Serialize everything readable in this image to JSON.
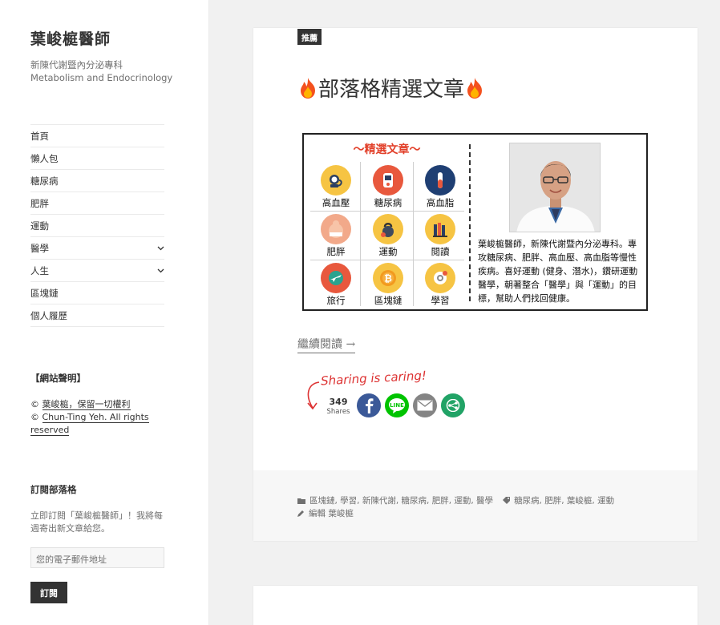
{
  "site": {
    "title": "葉峻榳醫師",
    "tagline_1": "新陳代謝暨內分泌專科",
    "tagline_2": "Metabolism and Endocrinology"
  },
  "nav": [
    {
      "label": "首頁",
      "has_submenu": false
    },
    {
      "label": "懶人包",
      "has_submenu": false
    },
    {
      "label": "糖尿病",
      "has_submenu": false
    },
    {
      "label": "肥胖",
      "has_submenu": false
    },
    {
      "label": "運動",
      "has_submenu": false
    },
    {
      "label": "醫學",
      "has_submenu": true
    },
    {
      "label": "人生",
      "has_submenu": true
    },
    {
      "label": "區塊鏈",
      "has_submenu": false
    },
    {
      "label": "個人履歷",
      "has_submenu": false
    }
  ],
  "notice_widget": {
    "title": "【網站聲明】",
    "line1_prefix": "© ",
    "line1_link": "葉峻榳，保留一切權利",
    "line2_prefix": "© ",
    "line2_link": "Chun-Ting Yeh. All rights reserved"
  },
  "subscribe_widget": {
    "title": "訂閱部落格",
    "text": "立即訂閱「葉峻榳醫師」！我將每週寄出新文章給您。",
    "email_placeholder": "您的電子郵件地址",
    "button_label": "訂閱"
  },
  "post": {
    "badge": "推薦",
    "title": "部落格精選文章",
    "featured_heading": "～精選文章～",
    "categories_grid": [
      {
        "label": "高血壓",
        "icon": "blood-pressure-icon",
        "color": "#f6c443"
      },
      {
        "label": "糖尿病",
        "icon": "glucose-meter-icon",
        "color": "#e8583d"
      },
      {
        "label": "高血脂",
        "icon": "test-tube-icon",
        "color": "#1f3f73"
      },
      {
        "label": "肥胖",
        "icon": "obesity-icon",
        "color": "#f2a98a"
      },
      {
        "label": "運動",
        "icon": "kettlebell-icon",
        "color": "#f6c443"
      },
      {
        "label": "閱讀",
        "icon": "books-icon",
        "color": "#f6c443"
      },
      {
        "label": "旅行",
        "icon": "airplane-icon",
        "color": "#e8583d"
      },
      {
        "label": "區塊鏈",
        "icon": "bitcoin-icon",
        "color": "#f6c443"
      },
      {
        "label": "學習",
        "icon": "brain-gear-icon",
        "color": "#f6c443"
      }
    ],
    "bio": "葉峻榳醫師，新陳代謝暨內分泌專科。專攻糖尿病、肥胖、高血壓、高血脂等慢性疾病。喜好運動 (健身、潛水)，鑽研運動醫學，朝著整合「醫學」與「運動」的目標，幫助人們找回健康。",
    "continue_reading": "繼續閱讀 →",
    "sharing_caption": "Sharing is caring!",
    "share_count": "349",
    "share_count_label": "Shares",
    "share_buttons": [
      {
        "name": "facebook",
        "color": "#3b5998"
      },
      {
        "name": "line",
        "color": "#00c300"
      },
      {
        "name": "email",
        "color": "#848484"
      },
      {
        "name": "more",
        "color": "#21a366"
      }
    ],
    "categories_text": "區塊鏈, 學習, 新陳代謝, 糖尿病, 肥胖, 運動, 醫學",
    "tags_text": "糖尿病, 肥胖, 葉峻榳, 運動",
    "edit_text": "編輯 葉峻榳"
  }
}
